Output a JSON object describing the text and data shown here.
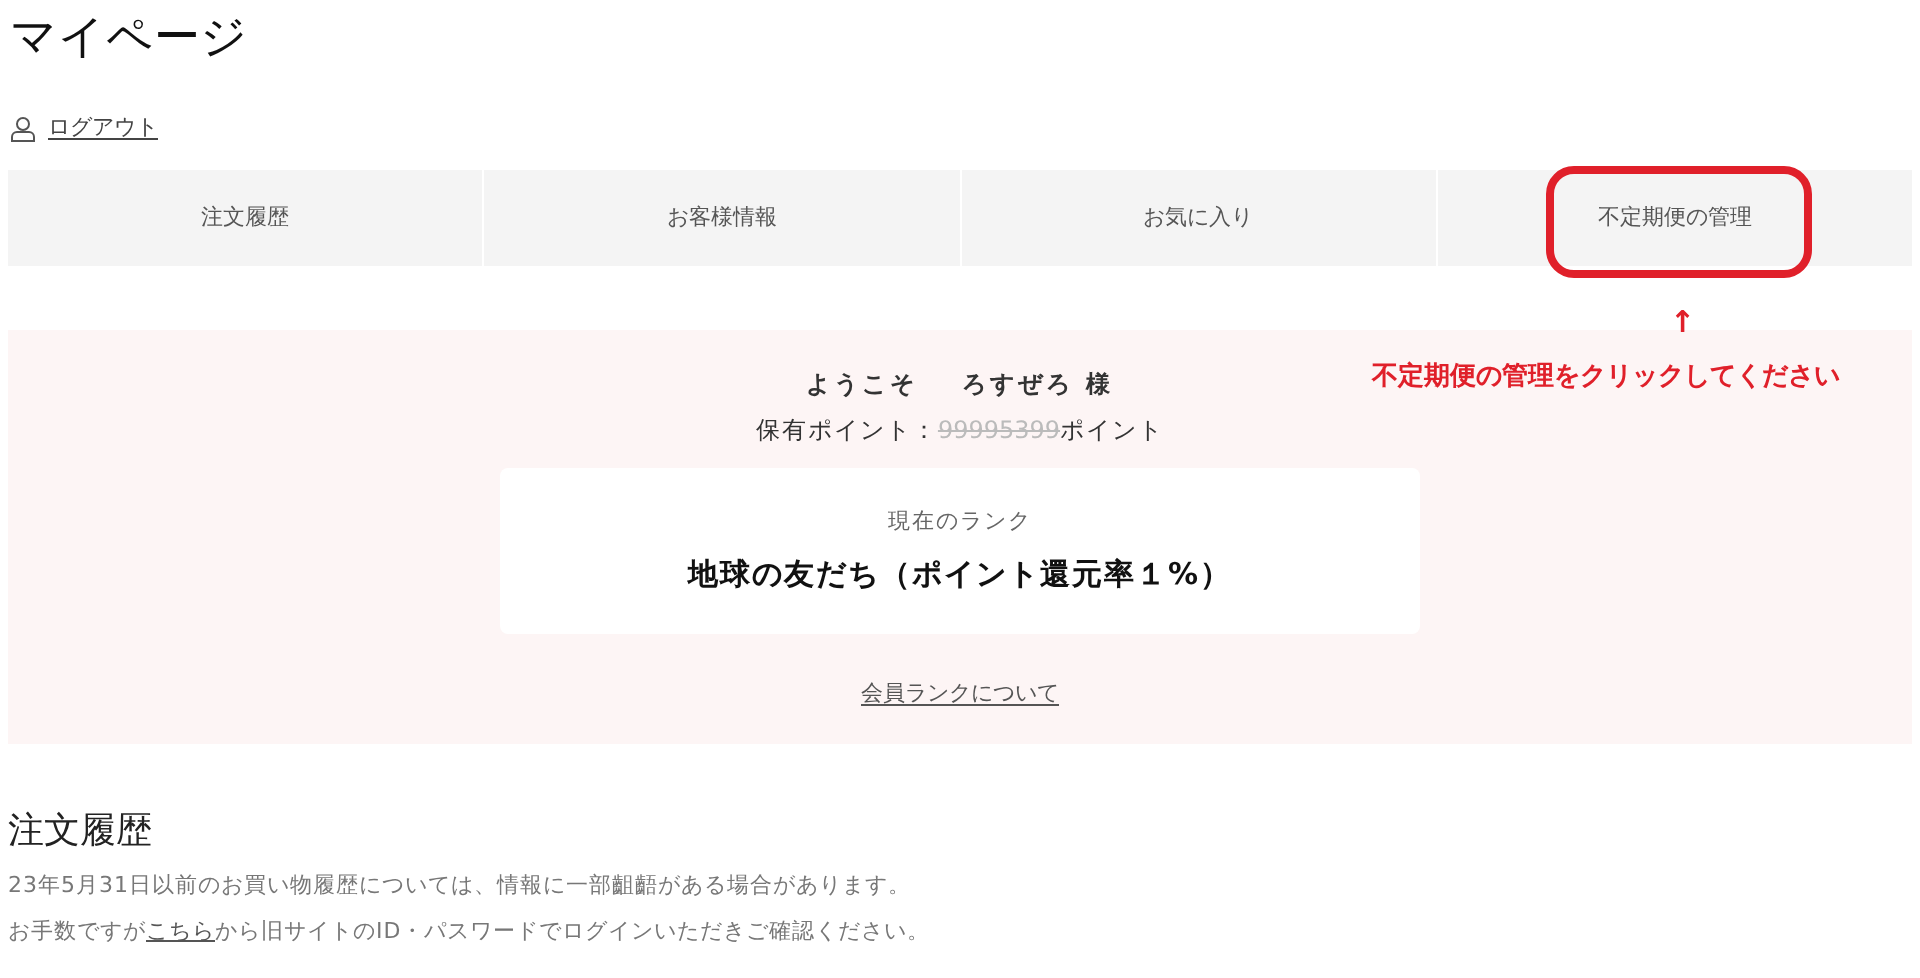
{
  "page_title": "マイページ",
  "logout": "ログアウト",
  "tabs": [
    {
      "label": "注文履歴",
      "highlighted": false
    },
    {
      "label": "お客様情報",
      "highlighted": false
    },
    {
      "label": "お気に入り",
      "highlighted": false
    },
    {
      "label": "不定期便の管理",
      "highlighted": true
    }
  ],
  "annotation": {
    "arrow": "↑",
    "text": "不定期便の管理をクリックしてください"
  },
  "welcome": {
    "greeting": "ようこそ",
    "name": "ろすぜろ 様",
    "points_label": "保有ポイント：",
    "points_value": "99995399",
    "points_unit": "ポイント",
    "rank_label": "現在のランク",
    "rank": "地球の友だち（ポイント還元率１%）",
    "rank_link": "会員ランクについて"
  },
  "history": {
    "title": "注文履歴",
    "note": "23年5月31日以前のお買い物履歴については、情報に一部齟齬がある場合があります。",
    "note2_before": "お手数ですが",
    "note2_link": "こちら",
    "note2_after": "から旧サイトのID・パスワードでログインいただきご確認ください。"
  }
}
